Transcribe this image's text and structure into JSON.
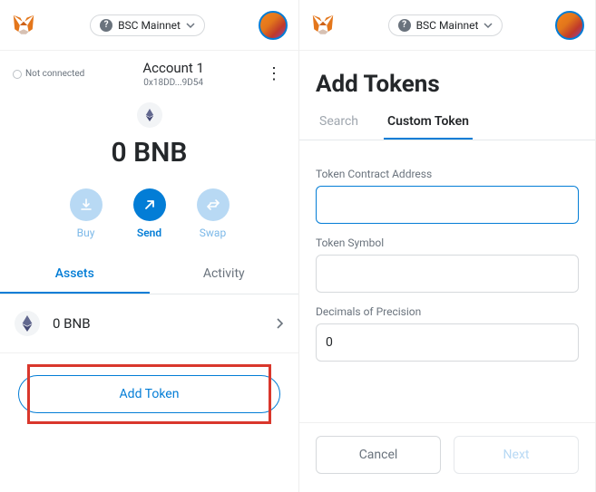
{
  "header": {
    "network": "BSC Mainnet"
  },
  "left": {
    "not_connected": "Not connected",
    "account_name": "Account 1",
    "account_address": "0x18DD...9D54",
    "balance": "0 BNB",
    "actions": {
      "buy": "Buy",
      "send": "Send",
      "swap": "Swap"
    },
    "tabs": {
      "assets": "Assets",
      "activity": "Activity"
    },
    "asset_row": "0 BNB",
    "add_token": "Add Token"
  },
  "right": {
    "title": "Add Tokens",
    "tabs": {
      "search": "Search",
      "custom": "Custom Token"
    },
    "fields": {
      "address_label": "Token Contract Address",
      "address_value": "",
      "symbol_label": "Token Symbol",
      "symbol_value": "",
      "decimals_label": "Decimals of Precision",
      "decimals_value": "0"
    },
    "buttons": {
      "cancel": "Cancel",
      "next": "Next"
    }
  }
}
